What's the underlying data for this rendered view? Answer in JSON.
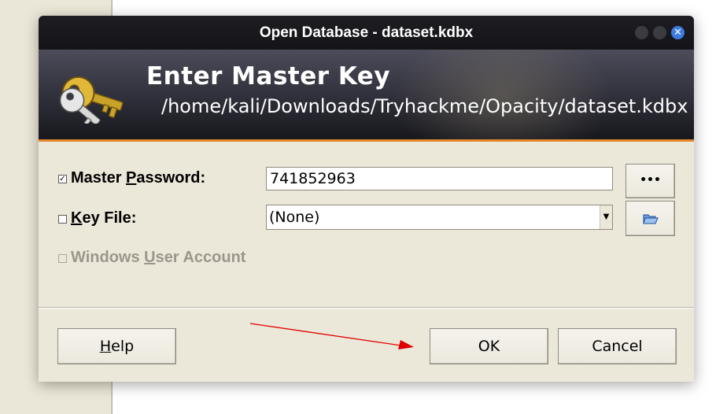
{
  "window": {
    "title": "Open Database - dataset.kdbx",
    "close_glyph": "✕"
  },
  "banner": {
    "heading": "Enter Master Key",
    "path": "/home/kali/Downloads/Tryhackme/Opacity/dataset.kdbx"
  },
  "form": {
    "master_password": {
      "checked": true,
      "check_glyph": "✓",
      "label_pre": "Master ",
      "label_mnemonic": "P",
      "label_post": "assword:",
      "value": "741852963",
      "reveal_button_label": "•••"
    },
    "key_file": {
      "checked": false,
      "label_mnemonic": "K",
      "label_post": "ey File:",
      "selected": "(None)",
      "dropdown_arrow": "▼"
    },
    "windows_user_account": {
      "label_pre": "Windows ",
      "label_mnemonic": "U",
      "label_post": "ser Account",
      "enabled": false
    }
  },
  "buttons": {
    "help_mnemonic": "H",
    "help_rest": "elp",
    "ok": "OK",
    "cancel": "Cancel"
  },
  "colors": {
    "accent_orange": "#e2862c",
    "dialog_bg": "#ece8d9",
    "titlebar": "#1d1d22",
    "close_button": "#3d7be0",
    "annotation_arrow": "#e00000"
  },
  "icons": {
    "banner": "key-icon",
    "browse": "folder-open-icon",
    "annotation": "red-arrow"
  }
}
